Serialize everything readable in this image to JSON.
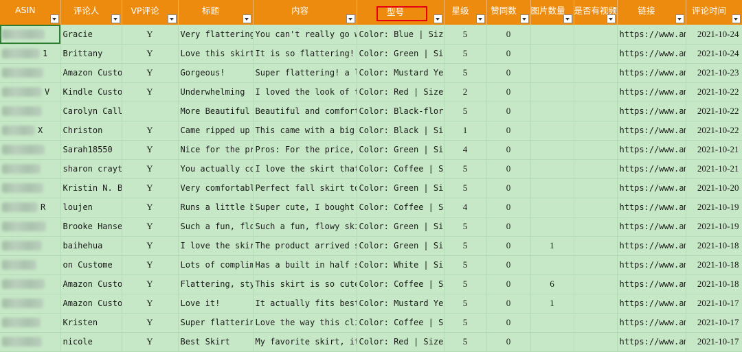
{
  "headers": {
    "asin": "ASIN",
    "reviewer": "评论人",
    "vp": "VP评论",
    "title": "标题",
    "content": "内容",
    "model": "型号",
    "stars": "星级",
    "likes": "赞同数",
    "images": "图片数量",
    "video": "是否有视频",
    "link": "链接",
    "date": "评论时间"
  },
  "rows": [
    {
      "asin_tail": "",
      "reviewer": "Gracie",
      "vp": "Y",
      "title": "Very flattering s",
      "content": "You can't really go wror",
      "model": "Color: Blue | Size:",
      "stars": "5",
      "likes": "0",
      "images": "",
      "video": "",
      "link": "https://www.ama",
      "date": "2021-10-24"
    },
    {
      "asin_tail": "1",
      "reviewer": "Brittany",
      "vp": "Y",
      "title": "Love this skirt",
      "content": "It is so flattering! Get",
      "model": "Color: Green | Size:",
      "stars": "5",
      "likes": "0",
      "images": "",
      "video": "",
      "link": "https://www.ama",
      "date": "2021-10-24"
    },
    {
      "asin_tail": "",
      "reviewer": "Amazon Custome",
      "vp": "Y",
      "title": "Gorgeous!",
      "content": "Super flattering! a litt",
      "model": "Color: Mustard Yello",
      "stars": "5",
      "likes": "0",
      "images": "",
      "video": "",
      "link": "https://www.ama",
      "date": "2021-10-23"
    },
    {
      "asin_tail": "V",
      "reviewer": "Kindle Custome",
      "vp": "Y",
      "title": "Underwhelming",
      "content": "I loved the look of this",
      "model": "Color: Red | Size: I",
      "stars": "2",
      "likes": "0",
      "images": "",
      "video": "",
      "link": "https://www.ama",
      "date": "2021-10-22"
    },
    {
      "asin_tail": "",
      "reviewer": "Carolyn Callop",
      "vp": "",
      "title": "More Beautiful Th",
      "content": "Beautiful and comfortabl",
      "model": "Color: Black-floral",
      "stars": "5",
      "likes": "0",
      "images": "",
      "video": "",
      "link": "https://www.ama",
      "date": "2021-10-22"
    },
    {
      "asin_tail": "X",
      "reviewer": "Christon",
      "vp": "Y",
      "title": "Came ripped up ar",
      "content": "This came with a big hol",
      "model": "Color: Black | Size:",
      "stars": "1",
      "likes": "0",
      "images": "",
      "video": "",
      "link": "https://www.ama",
      "date": "2021-10-22"
    },
    {
      "asin_tail": "",
      "reviewer": "Sarah18550",
      "vp": "Y",
      "title": "Nice for the pric",
      "content": "Pros: For the price, the",
      "model": "Color: Green | Size:",
      "stars": "4",
      "likes": "0",
      "images": "",
      "video": "",
      "link": "https://www.ama",
      "date": "2021-10-21"
    },
    {
      "asin_tail": "",
      "reviewer": "sharon crayton",
      "vp": "Y",
      "title": "You actually coul",
      "content": "I love the skirt that I",
      "model": "Color: Coffee | Size",
      "stars": "5",
      "likes": "0",
      "images": "",
      "video": "",
      "link": "https://www.ama",
      "date": "2021-10-21"
    },
    {
      "asin_tail": "",
      "reviewer": "Kristin N. Ber",
      "vp": "Y",
      "title": "Very comfortable!",
      "content": "Perfect fall skirt to we",
      "model": "Color: Green | Size:",
      "stars": "5",
      "likes": "0",
      "images": "",
      "video": "",
      "link": "https://www.ama",
      "date": "2021-10-20"
    },
    {
      "asin_tail": "R",
      "reviewer": "loujen",
      "vp": "Y",
      "title": "Runs a little big",
      "content": "Super cute, I bought thr",
      "model": "Color: Coffee | Size",
      "stars": "4",
      "likes": "0",
      "images": "",
      "video": "",
      "link": "https://www.ama",
      "date": "2021-10-19"
    },
    {
      "asin_tail": "",
      "reviewer": "Brooke Hansen",
      "vp": "Y",
      "title": "Such a fun, flowy",
      "content": "Such a fun, flowy skirt!",
      "model": "Color: Green | Size:",
      "stars": "5",
      "likes": "0",
      "images": "",
      "video": "",
      "link": "https://www.ama",
      "date": "2021-10-19"
    },
    {
      "asin_tail": "",
      "reviewer": "baihehua",
      "vp": "Y",
      "title": "I love the skirt",
      "content": "The product arrived so c",
      "model": "Color: Green | Size:",
      "stars": "5",
      "likes": "0",
      "images": "1",
      "video": "",
      "link": "https://www.ama",
      "date": "2021-10-18"
    },
    {
      "asin_tail": "",
      "reviewer": "on Custome",
      "vp": "Y",
      "title": "Lots of complimer",
      "content": "Has a built in half slip",
      "model": "Color: White | Size:",
      "stars": "5",
      "likes": "0",
      "images": "",
      "video": "",
      "link": "https://www.ama",
      "date": "2021-10-18"
    },
    {
      "asin_tail": "",
      "reviewer": "Amazon Custome",
      "vp": "Y",
      "title": "Flattering, styli",
      "content": "This skirt is so cute! I",
      "model": "Color: Coffee | Size",
      "stars": "5",
      "likes": "0",
      "images": "6",
      "video": "",
      "link": "https://www.ama",
      "date": "2021-10-18"
    },
    {
      "asin_tail": "",
      "reviewer": "Amazon Custome",
      "vp": "Y",
      "title": "Love it!",
      "content": "It actually fits best wh",
      "model": "Color: Mustard Yello",
      "stars": "5",
      "likes": "0",
      "images": "1",
      "video": "",
      "link": "https://www.ama",
      "date": "2021-10-17"
    },
    {
      "asin_tail": "",
      "reviewer": "Kristen",
      "vp": "Y",
      "title": "Super flattering",
      "content": "Love the way this clings",
      "model": "Color: Coffee | Size",
      "stars": "5",
      "likes": "0",
      "images": "",
      "video": "",
      "link": "https://www.ama",
      "date": "2021-10-17"
    },
    {
      "asin_tail": "",
      "reviewer": "nicole",
      "vp": "Y",
      "title": "Best Skirt",
      "content": "My favorite skirt, it fi",
      "model": "Color: Red | Size: S",
      "stars": "5",
      "likes": "0",
      "images": "",
      "video": "",
      "link": "https://www.ama",
      "date": "2021-10-17"
    }
  ]
}
